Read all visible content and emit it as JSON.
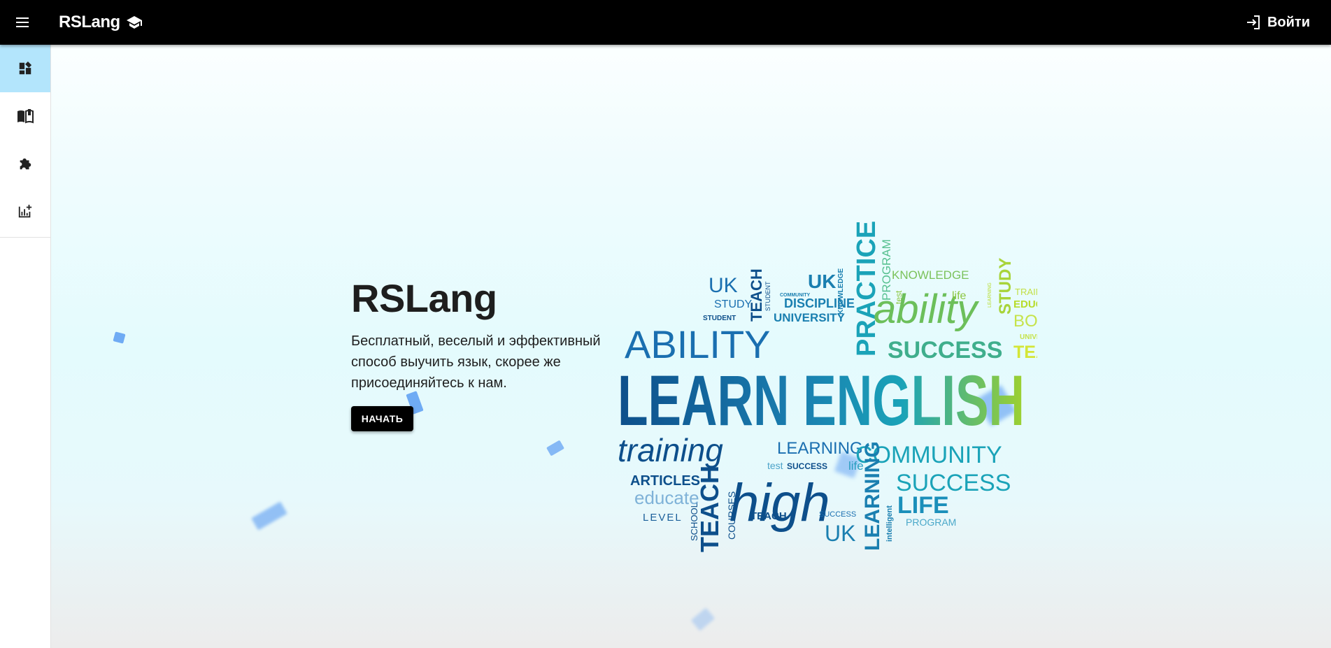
{
  "header": {
    "brand": "RSLang",
    "menu_icon": "menu-icon",
    "brand_icon": "graduation-cap-icon",
    "login_label": "Войти",
    "login_icon": "login-icon"
  },
  "sidebar": {
    "items": [
      {
        "icon": "dashboard-icon",
        "active": true
      },
      {
        "icon": "book-icon",
        "active": false
      },
      {
        "icon": "puzzle-icon",
        "active": false
      },
      {
        "icon": "statistics-icon",
        "active": false
      }
    ],
    "active_color": "#b3e5fc"
  },
  "hero": {
    "title": "RSLang",
    "description": "Бесплатный, веселый и эффективный способ выучить язык, скорее же присоединяйтесь к нам.",
    "start_label": "НАЧАТЬ"
  },
  "word_cloud": {
    "main": "LEARN ENGLISH",
    "words": [
      "UK",
      "STUDY",
      "STUDENT",
      "TEACH",
      "STUDENT",
      "UK",
      "COMMUNITY",
      "DISCIPLINE",
      "UNIVERSITY",
      "KNOWLEDGE",
      "PRACTICE",
      "PROGRAM",
      "test",
      "KNOWLEDGE",
      "ability",
      "life",
      "LEARNING",
      "STUDY",
      "TRAINING",
      "EDUCATE",
      "BOOKS",
      "UNIVERSITY",
      "TEACH",
      "ABILITY",
      "SUCCESS",
      "training",
      "LEARNING",
      "COMMUNITY",
      "test",
      "SUCCESS",
      "life",
      "SUCCESS",
      "ARTICLES",
      "educate",
      "LEVEL",
      "SCHOOL",
      "TEACH",
      "COURSES",
      "high",
      "TEACH",
      "SUCCESS",
      "UK",
      "LEARNING",
      "intelligent",
      "LIFE",
      "PROGRAM"
    ]
  },
  "colors": {
    "appbar": "#000000",
    "cloud_dark": "#0d4f8b",
    "cloud_teal": "#1aa3b8",
    "cloud_green": "#8cc63f",
    "confetti": "#5b9cf2"
  }
}
